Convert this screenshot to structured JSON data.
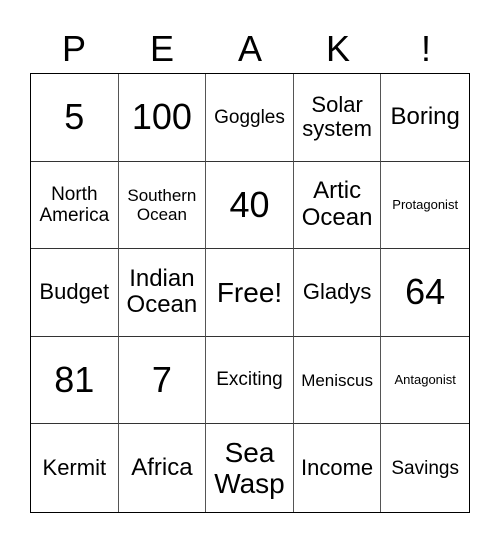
{
  "header": [
    "P",
    "E",
    "A",
    "K",
    "!"
  ],
  "cells": [
    "5",
    "100",
    "Goggles",
    "Solar system",
    "Boring",
    "North America",
    "Southern Ocean",
    "40",
    "Artic Ocean",
    "Protagonist",
    "Budget",
    "Indian Ocean",
    "Free!",
    "Gladys",
    "64",
    "81",
    "7",
    "Exciting",
    "Meniscus",
    "Antagonist",
    "Kermit",
    "Africa",
    "Sea Wasp",
    "Income",
    "Savings"
  ]
}
